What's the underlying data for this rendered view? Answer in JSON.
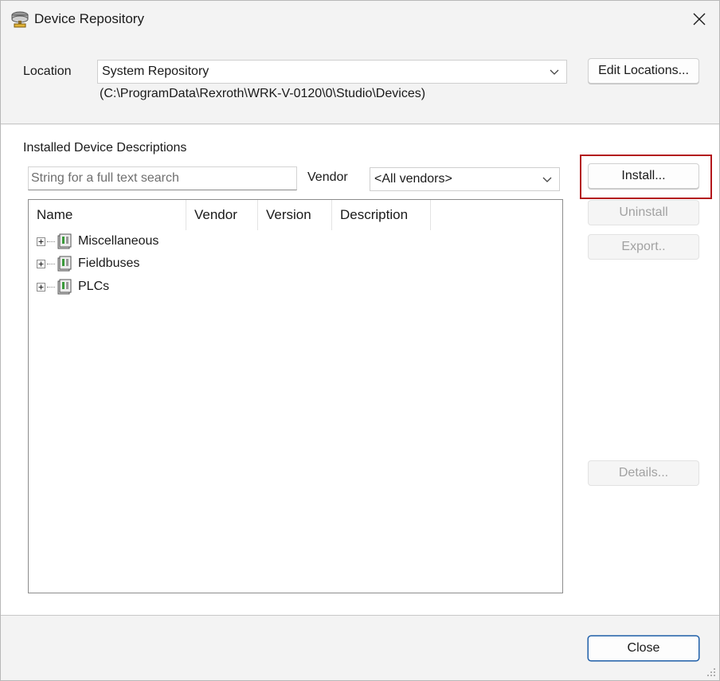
{
  "window": {
    "title": "Device Repository",
    "icon": "device-repository-icon"
  },
  "location": {
    "label": "Location",
    "selected": "System Repository",
    "path": "(C:\\ProgramData\\Rexroth\\WRK-V-0120\\0\\Studio\\Devices)",
    "edit_button": "Edit Locations..."
  },
  "installed": {
    "section_label": "Installed Device Descriptions",
    "search_placeholder": "String for a full text search",
    "vendor_label": "Vendor",
    "vendor_selected": "<All vendors>",
    "columns": [
      "Name",
      "Vendor",
      "Version",
      "Description"
    ],
    "items": [
      {
        "label": "Miscellaneous"
      },
      {
        "label": "Fieldbuses"
      },
      {
        "label": "PLCs"
      }
    ]
  },
  "buttons": {
    "install": "Install...",
    "uninstall": "Uninstall",
    "export": "Export..",
    "details": "Details...",
    "close": "Close"
  },
  "colors": {
    "highlight_border": "#b3171c",
    "primary_border": "#1f5fa8"
  }
}
